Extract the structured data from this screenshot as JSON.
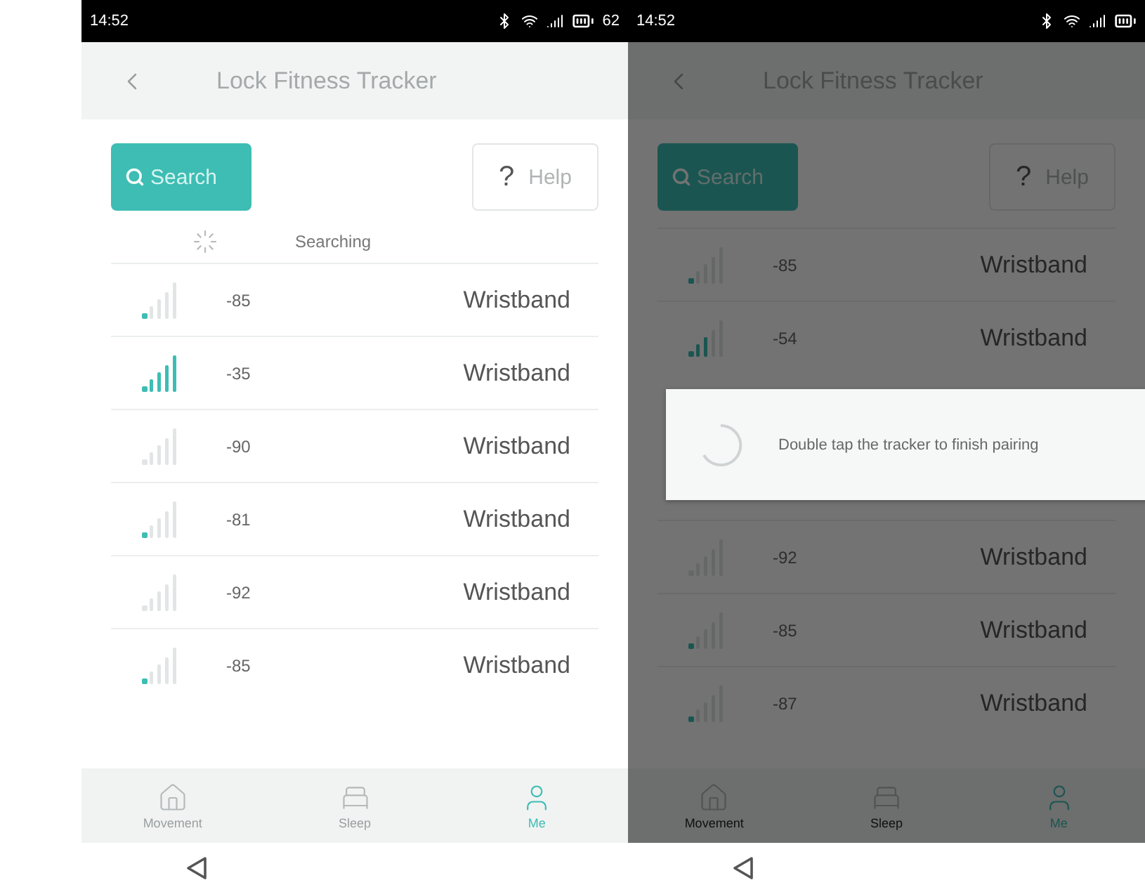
{
  "screens": [
    {
      "dimmed": false,
      "status_bar": {
        "time": "14:52",
        "battery": "62"
      },
      "header": {
        "title": "Lock Fitness Tracker"
      },
      "search_button": "Search",
      "help_button": {
        "mark": "?",
        "label": "Help"
      },
      "searching": "Searching",
      "devices": [
        {
          "kind": "weak",
          "rssi": "-85",
          "name": "Wristband"
        },
        {
          "kind": "strong",
          "rssi": "-35",
          "name": "Wristband"
        },
        {
          "kind": "none",
          "rssi": "-90",
          "name": "Wristband"
        },
        {
          "kind": "weak",
          "rssi": "-81",
          "name": "Wristband"
        },
        {
          "kind": "none",
          "rssi": "-92",
          "name": "Wristband"
        },
        {
          "kind": "weak",
          "rssi": "-85",
          "name": "Wristband"
        }
      ],
      "nav": [
        {
          "kind": "home",
          "label": "Movement",
          "selected": false
        },
        {
          "kind": "bed",
          "label": "Sleep",
          "selected": false
        },
        {
          "kind": "person",
          "label": "Me",
          "selected": true
        }
      ]
    },
    {
      "dimmed": true,
      "status_bar": {
        "time": "14:52"
      },
      "header": {
        "title": "Lock Fitness Tracker"
      },
      "search_button": "Search",
      "help_button": {
        "mark": "?",
        "label": "Help"
      },
      "devices": [
        {
          "kind": "weak",
          "rssi": "-85",
          "name": "Wristband"
        },
        {
          "kind": "medium",
          "rssi": "-54",
          "name": "Wristband"
        }
      ],
      "dialog": {
        "message": "Double tap the tracker to finish pairing"
      },
      "devices_after_dialog": [
        {
          "kind": "none",
          "rssi": "-92",
          "name": "Wristband"
        },
        {
          "kind": "weak",
          "rssi": "-85",
          "name": "Wristband"
        },
        {
          "kind": "weak",
          "rssi": "-87",
          "name": "Wristband"
        }
      ],
      "nav": [
        {
          "kind": "home",
          "label": "Movement",
          "selected": false
        },
        {
          "kind": "bed",
          "label": "Sleep",
          "selected": false
        },
        {
          "kind": "person",
          "label": "Me",
          "selected": true
        }
      ]
    }
  ]
}
